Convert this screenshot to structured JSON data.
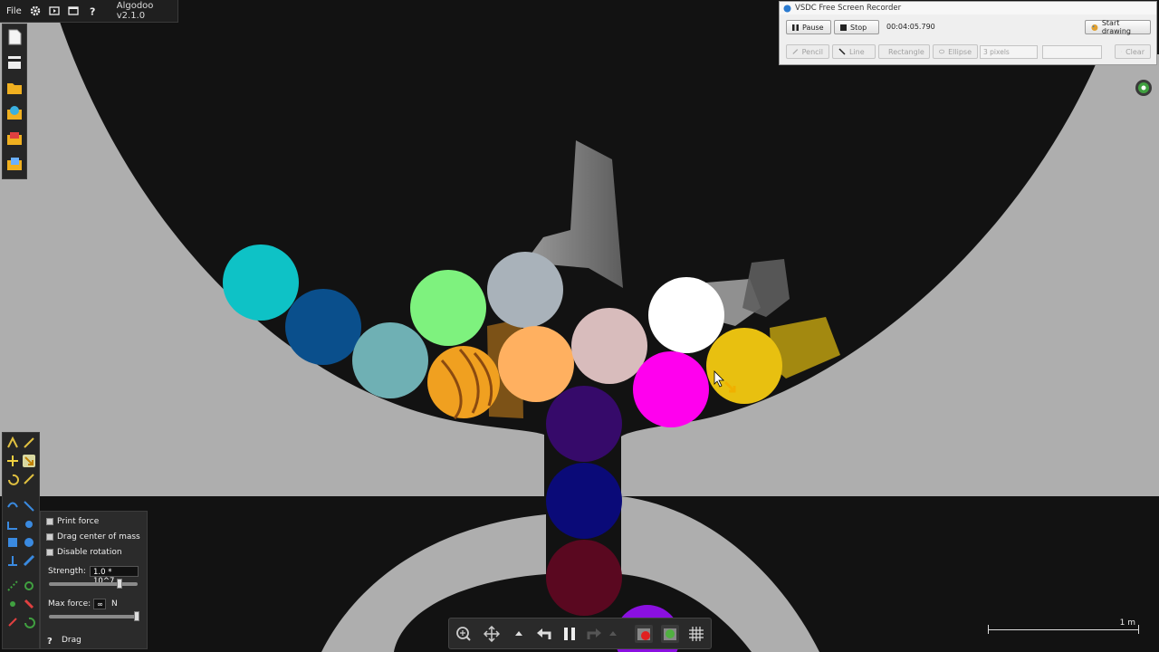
{
  "app": {
    "title": "Algodoo v2.1.0",
    "menu_file": "File"
  },
  "drag_options": {
    "print_force": "Print force",
    "drag_center_of_mass": "Drag center of mass",
    "disable_rotation": "Disable rotation",
    "strength_label": "Strength:",
    "strength_value": "1.0 * 10^7",
    "max_force_label": "Max force:",
    "max_force_value": "∞",
    "max_force_unit": "N",
    "tool_label": "Drag"
  },
  "recorder": {
    "title": "VSDC Free Screen Recorder",
    "pause": "Pause",
    "stop": "Stop",
    "time": "00:04:05.790",
    "start_drawing": "Start drawing",
    "pencil": "Pencil",
    "line": "Line",
    "rectangle": "Rectangle",
    "ellipse": "Ellipse",
    "thickness": "3 pixels",
    "clear": "Clear"
  },
  "scale_bar": {
    "label": "1 m"
  },
  "colors": {
    "scene_bg": "#121212",
    "wall_gray": "#aeaeae",
    "ball_cyan": "#0ec2c6",
    "ball_navy_blue": "#0a4f8c",
    "ball_teal_gray": "#6fb0b4",
    "ball_light_green": "#7ef27e",
    "ball_orange_striped": "#f0a020",
    "ball_silver": "#a9b2ba",
    "ball_peach": "#ffb060",
    "ball_pink_gray": "#d8bcbc",
    "ball_white": "#ffffff",
    "ball_magenta": "#ff00ee",
    "ball_yellow": "#e8c010",
    "ball_indigo": "#360a6a",
    "ball_dark_navy": "#0a0a78",
    "ball_maroon": "#5a0820",
    "ball_violet": "#8a10e0"
  }
}
